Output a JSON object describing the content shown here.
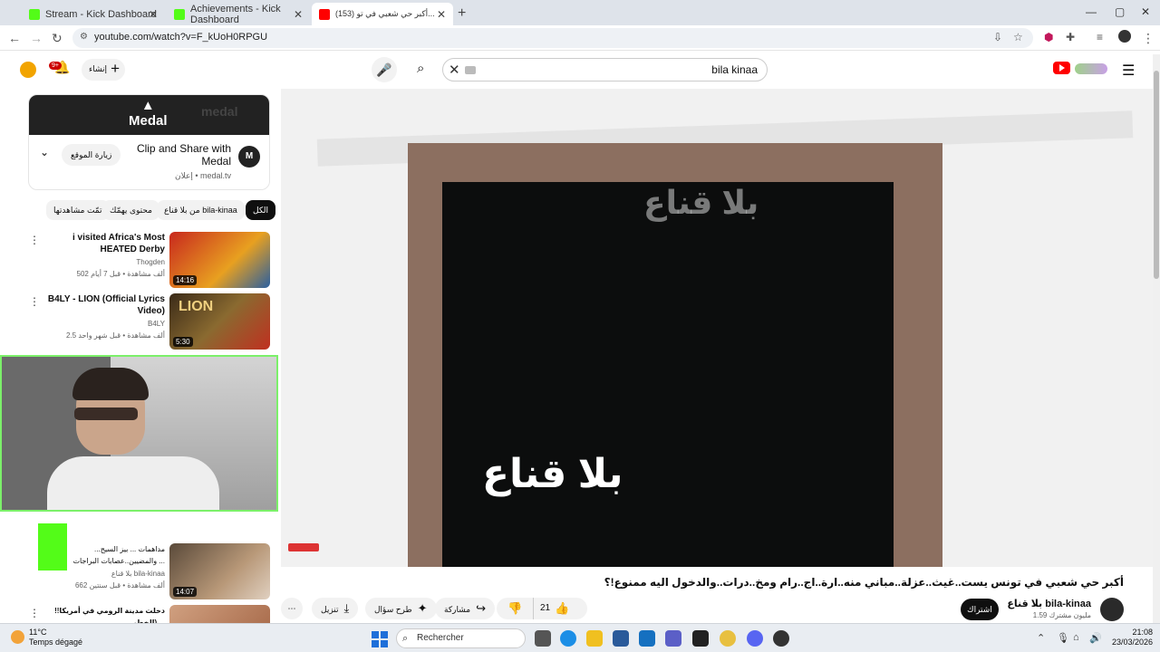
{
  "browser": {
    "tabs": [
      {
        "title": "Stream - Kick Dashboard",
        "color": "#53fc18"
      },
      {
        "title": "Achievements - Kick Dashboard",
        "color": "#53fc18"
      },
      {
        "title": "(153) أكبر حي شعبي في تو...",
        "color": "#ff0000"
      }
    ],
    "url": "youtube.com/watch?v=F_kUoH0RPGU"
  },
  "youtube": {
    "search_value": "bila kinaa",
    "create_label": "إنشاء",
    "notification_count": "9+",
    "ad": {
      "title": "Clip and Share with Medal",
      "sponsor": "إعلان • medal.tv",
      "visit_label": "زيارة الموقع",
      "banner_text": "Medal"
    },
    "chips": [
      "الكل",
      "من بلا قناع bila-kinaa",
      "محتوى يهمّك",
      "تمّت مشاهدتها"
    ],
    "related": [
      {
        "title": "i visited Africa's Most HEATED Derby",
        "channel": "Thogden",
        "meta": "502 ألف مشاهدة • قبل 7 أيام",
        "duration": "14:16"
      },
      {
        "title": "B4LY - LION (Official Lyrics Video)",
        "channel": "B4LY",
        "meta": "2.5 ألف مشاهدة • قبل شهر واحد",
        "duration": "5:30"
      },
      {
        "title": "مداهمات ... بيز السيح... والمضيين..عصابات البراجات ...",
        "channel": "بلا قناع bila-kinaa",
        "meta": "662 ألف مشاهدة • قبل سنتين",
        "duration": "14:07"
      },
      {
        "title": "دخلت مدينة الرومي في أمريكا!! (الخطر ...",
        "channel": "",
        "meta": "",
        "duration": ""
      }
    ],
    "video_watermark": "بلا قناع",
    "video_title": "أكبر حي شعبي في تونس يست..غيث..عزلة..مباني منه..ارة..اج..رام ومخ..درات..والدخول اليه ممنوع!؟",
    "actions": {
      "likes": "21",
      "share": "مشاركة",
      "ask": "طرح سؤال",
      "download": "تنزيل"
    },
    "channel": {
      "name": "بلا قناع bila-kinaa",
      "subs": "1.59 مليون مشترك",
      "subscribe": "اشتراك"
    }
  },
  "taskbar": {
    "temp": "11°C",
    "weather": "Temps dégagé",
    "search_placeholder": "Rechercher",
    "time": "21:08",
    "date": "23/03/2026"
  }
}
